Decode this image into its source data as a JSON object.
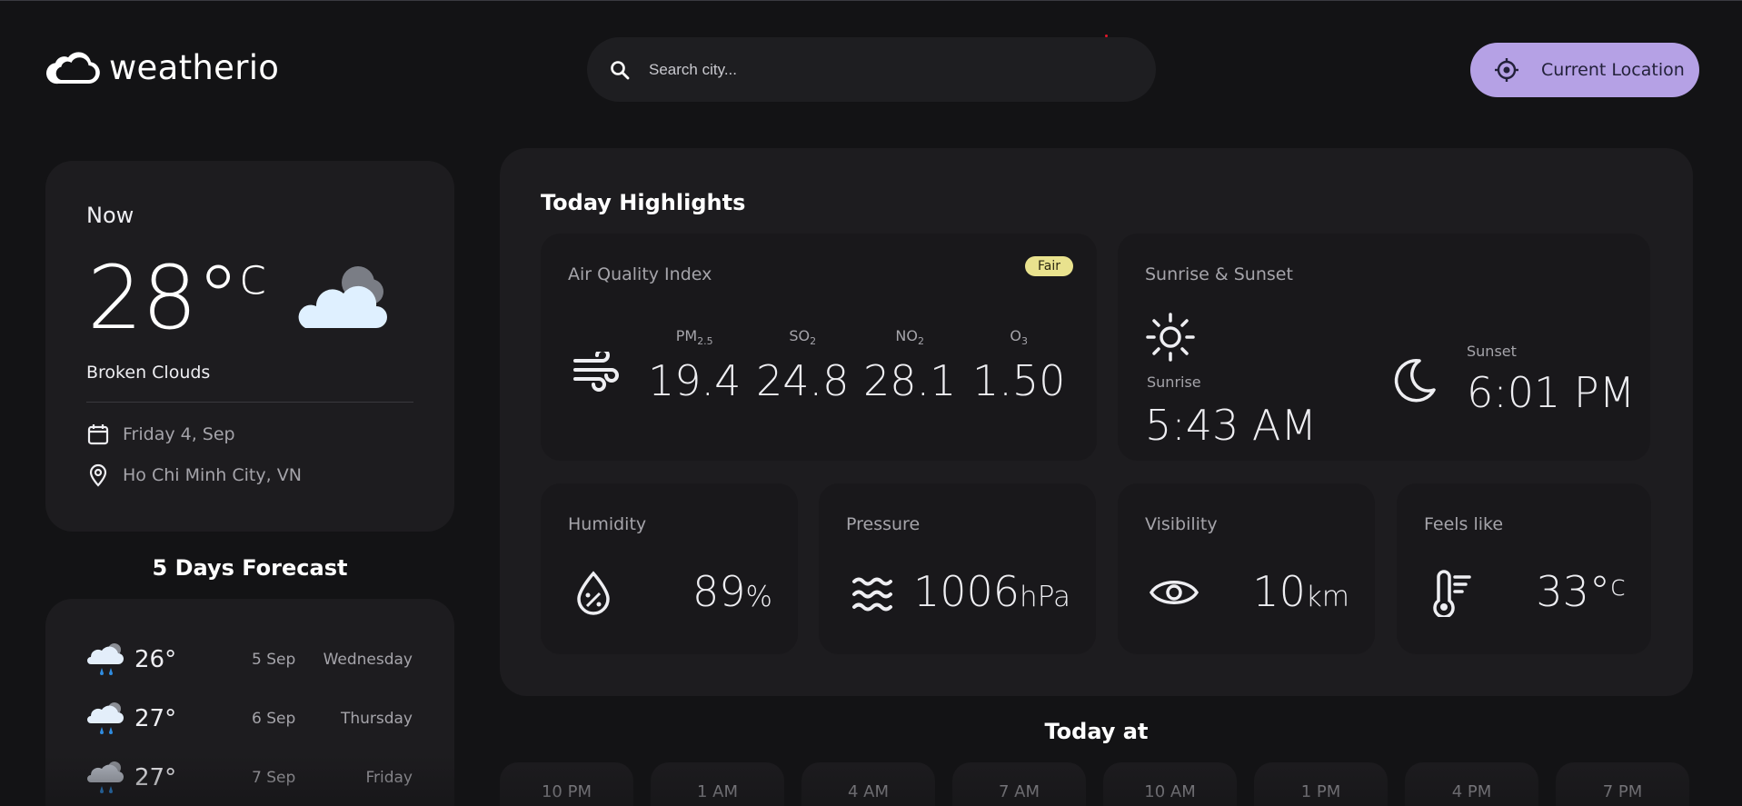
{
  "app": {
    "name": "weatherio"
  },
  "search": {
    "placeholder": "Search city..."
  },
  "location_button": {
    "label": "Current Location"
  },
  "now": {
    "label": "Now",
    "temp": "28°",
    "unit": "c",
    "description": "Broken Clouds",
    "date": "Friday 4, Sep",
    "location": "Ho Chi Minh City, VN"
  },
  "forecast": {
    "title": "5 Days Forecast",
    "days": [
      {
        "temp": "26°",
        "date": "5 Sep",
        "weekday": "Wednesday"
      },
      {
        "temp": "27°",
        "date": "6 Sep",
        "weekday": "Thursday"
      },
      {
        "temp": "27°",
        "date": "7 Sep",
        "weekday": "Friday"
      }
    ]
  },
  "highlights": {
    "title": "Today Highlights",
    "aqi": {
      "title": "Air Quality Index",
      "badge": "Fair",
      "items": [
        {
          "label": "PM",
          "sub": "2.5",
          "value": "19.4"
        },
        {
          "label": "SO",
          "sub": "2",
          "value": "24.8"
        },
        {
          "label": "NO",
          "sub": "2",
          "value": "28.1"
        },
        {
          "label": "O",
          "sub": "3",
          "value": "1.50"
        }
      ]
    },
    "sun": {
      "title": "Sunrise & Sunset",
      "sunrise_label": "Sunrise",
      "sunrise": "5:43 AM",
      "sunset_label": "Sunset",
      "sunset": "6:01 PM"
    },
    "humidity": {
      "title": "Humidity",
      "value": "89",
      "unit": "%"
    },
    "pressure": {
      "title": "Pressure",
      "value": "1006",
      "unit": "hPa"
    },
    "visibility": {
      "title": "Visibility",
      "value": "10",
      "unit": "km"
    },
    "feels_like": {
      "title": "Feels like",
      "value": "33°",
      "unit": "c"
    }
  },
  "today_at": {
    "title": "Today at",
    "hours": [
      "10 PM",
      "1 AM",
      "4 AM",
      "7 AM",
      "10 AM",
      "1 PM",
      "4 PM",
      "7 PM"
    ]
  },
  "colors": {
    "accent": "#b5a1e5",
    "badge_fair": "#e9e28e",
    "background": "#131315",
    "card": "#1d1c1f"
  }
}
